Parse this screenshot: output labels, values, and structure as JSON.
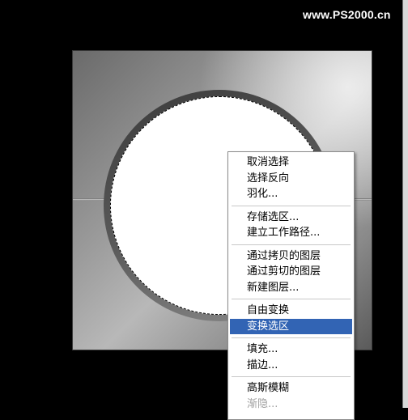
{
  "watermark": {
    "text": "www.PS2000.cn"
  },
  "context_menu": {
    "groups": [
      [
        "取消选择",
        "选择反向",
        "羽化..."
      ],
      [
        "存储选区...",
        "建立工作路径..."
      ],
      [
        "通过拷贝的图层",
        "通过剪切的图层",
        "新建图层..."
      ],
      [
        "自由变换",
        "变换选区"
      ],
      [
        "填充...",
        "描边..."
      ],
      [
        "高斯模糊",
        "渐隐..."
      ]
    ],
    "highlighted": "变换选区",
    "disabled": [
      "渐隐..."
    ]
  },
  "colors": {
    "highlight": "#3264b4",
    "background": "#000000"
  }
}
